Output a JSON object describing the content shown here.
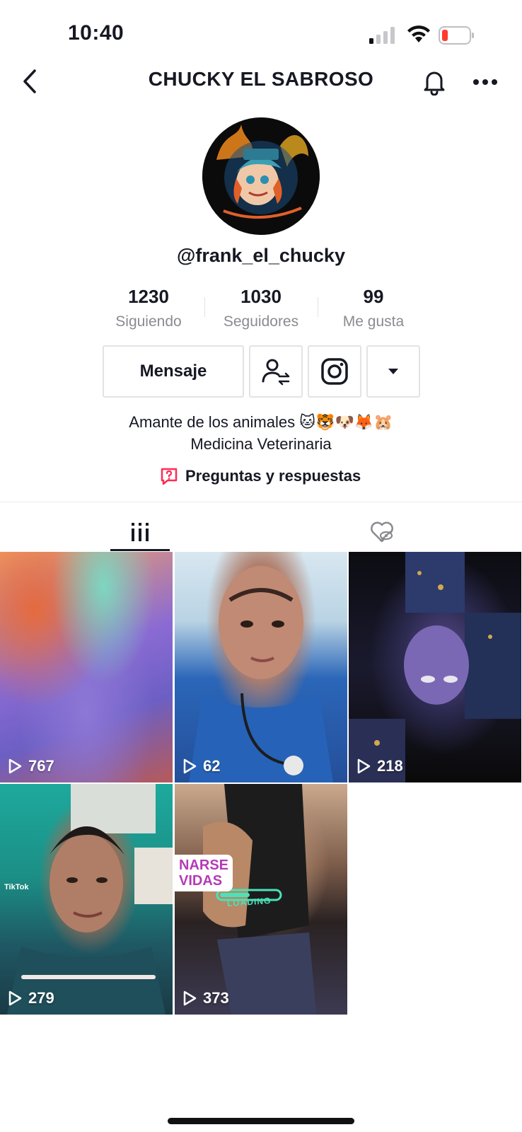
{
  "status_bar": {
    "time": "10:40",
    "battery_color": "#ff3b30"
  },
  "header": {
    "title": "CHUCKY EL SABROSO"
  },
  "profile": {
    "username": "@frank_el_chucky",
    "stats": [
      {
        "value": "1230",
        "label": "Siguiendo"
      },
      {
        "value": "1030",
        "label": "Seguidores"
      },
      {
        "value": "99",
        "label": "Me gusta"
      }
    ],
    "actions": {
      "message_label": "Mensaje"
    },
    "bio": {
      "line1": "Amante de los animales 🐱🐯🐶🦊🐹",
      "line2": "Medicina Veterinaria"
    },
    "qa_label": "Preguntas y respuestas"
  },
  "tabs": [
    {
      "icon": "video-grid-icon",
      "active": true
    },
    {
      "icon": "liked-hidden-icon",
      "active": false
    }
  ],
  "videos": [
    {
      "views": "767"
    },
    {
      "views": "62"
    },
    {
      "views": "218"
    },
    {
      "views": "279"
    },
    {
      "views": "373"
    }
  ],
  "video_overlays": {
    "tile5_text1": "NARSE",
    "tile5_text2": "VIDAS",
    "tile5_loading": "LOADING",
    "tile4_watermark": "TikTok"
  },
  "colors": {
    "accent": "#fe2c55",
    "text_primary": "#161823",
    "text_secondary": "#8a8b91"
  }
}
